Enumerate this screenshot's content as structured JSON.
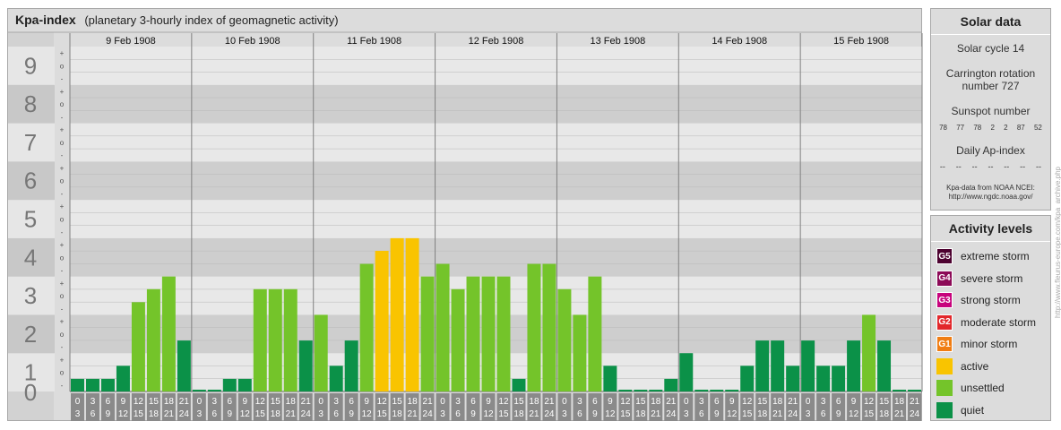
{
  "header": {
    "title": "Kpa-index",
    "subtitle": "(planetary 3-hourly index of geomagnetic activity)"
  },
  "chart_data": {
    "type": "bar",
    "title": "Kpa-index",
    "subtitle": "(planetary 3-hourly index of geomagnetic activity)",
    "ylim": [
      0,
      9
    ],
    "y_ticks": [
      "0",
      "1",
      "2",
      "3",
      "4",
      "5",
      "6",
      "7",
      "8",
      "9"
    ],
    "y_subticks": [
      "-",
      "o",
      "+"
    ],
    "days": [
      "9 Feb 1908",
      "10 Feb 1908",
      "11 Feb 1908",
      "12 Feb 1908",
      "13 Feb 1908",
      "14 Feb 1908",
      "15 Feb 1908"
    ],
    "intervals": [
      [
        "0",
        "3"
      ],
      [
        "3",
        "6"
      ],
      [
        "6",
        "9"
      ],
      [
        "9",
        "12"
      ],
      [
        "12",
        "15"
      ],
      [
        "15",
        "18"
      ],
      [
        "18",
        "21"
      ],
      [
        "21",
        "24"
      ]
    ],
    "values": [
      [
        0.33,
        0.33,
        0.33,
        0.67,
        2.33,
        2.67,
        3.0,
        1.33
      ],
      [
        0.0,
        0.0,
        0.33,
        0.33,
        2.67,
        2.67,
        2.67,
        1.33
      ],
      [
        2.0,
        0.67,
        1.33,
        3.33,
        3.67,
        4.0,
        4.0,
        3.0
      ],
      [
        3.33,
        2.67,
        3.0,
        3.0,
        3.0,
        0.33,
        3.33,
        3.33
      ],
      [
        2.67,
        2.0,
        3.0,
        0.67,
        0.0,
        0.0,
        0.0,
        0.33
      ],
      [
        1.0,
        0.0,
        0.0,
        0.0,
        0.67,
        1.33,
        1.33,
        0.67
      ],
      [
        1.33,
        0.67,
        0.67,
        1.33,
        2.0,
        1.33,
        0.0,
        0.0
      ]
    ],
    "grid": true,
    "colors": {
      "quiet": "#0b9148",
      "unsettled": "#74c42a",
      "active": "#f9c400",
      "minor": "#f07d13",
      "moderate": "#e2272b",
      "strong": "#c7037c",
      "severe": "#8c0a57",
      "extreme": "#4d0230"
    }
  },
  "solar": {
    "title": "Solar data",
    "cycle": "Solar cycle 14",
    "carrington": "Carrington rotation number 727",
    "sunspot_title": "Sunspot number",
    "sunspots": [
      "78",
      "77",
      "78",
      "2",
      "2",
      "87",
      "52"
    ],
    "ap_title": "Daily Ap-index",
    "ap": [
      "--",
      "--",
      "--",
      "--",
      "--",
      "--",
      "--"
    ],
    "credit_line1": "Kpa-data from NOAA NCEI:",
    "credit_line2": "http://www.ngdc.noaa.gov/"
  },
  "levels": {
    "title": "Activity levels",
    "items": [
      {
        "code": "G5",
        "label": "extreme storm",
        "color": "#4d0230"
      },
      {
        "code": "G4",
        "label": "severe storm",
        "color": "#8c0a57"
      },
      {
        "code": "G3",
        "label": "strong storm",
        "color": "#c7037c"
      },
      {
        "code": "G2",
        "label": "moderate storm",
        "color": "#e2272b"
      },
      {
        "code": "G1",
        "label": "minor storm",
        "color": "#f07d13"
      },
      {
        "code": "",
        "label": "active",
        "color": "#f9c400"
      },
      {
        "code": "",
        "label": "unsettled",
        "color": "#74c42a"
      },
      {
        "code": "",
        "label": "quiet",
        "color": "#0b9148"
      }
    ]
  },
  "watermark": "http://www.fleurus-europe.com/kpa_archive.php"
}
